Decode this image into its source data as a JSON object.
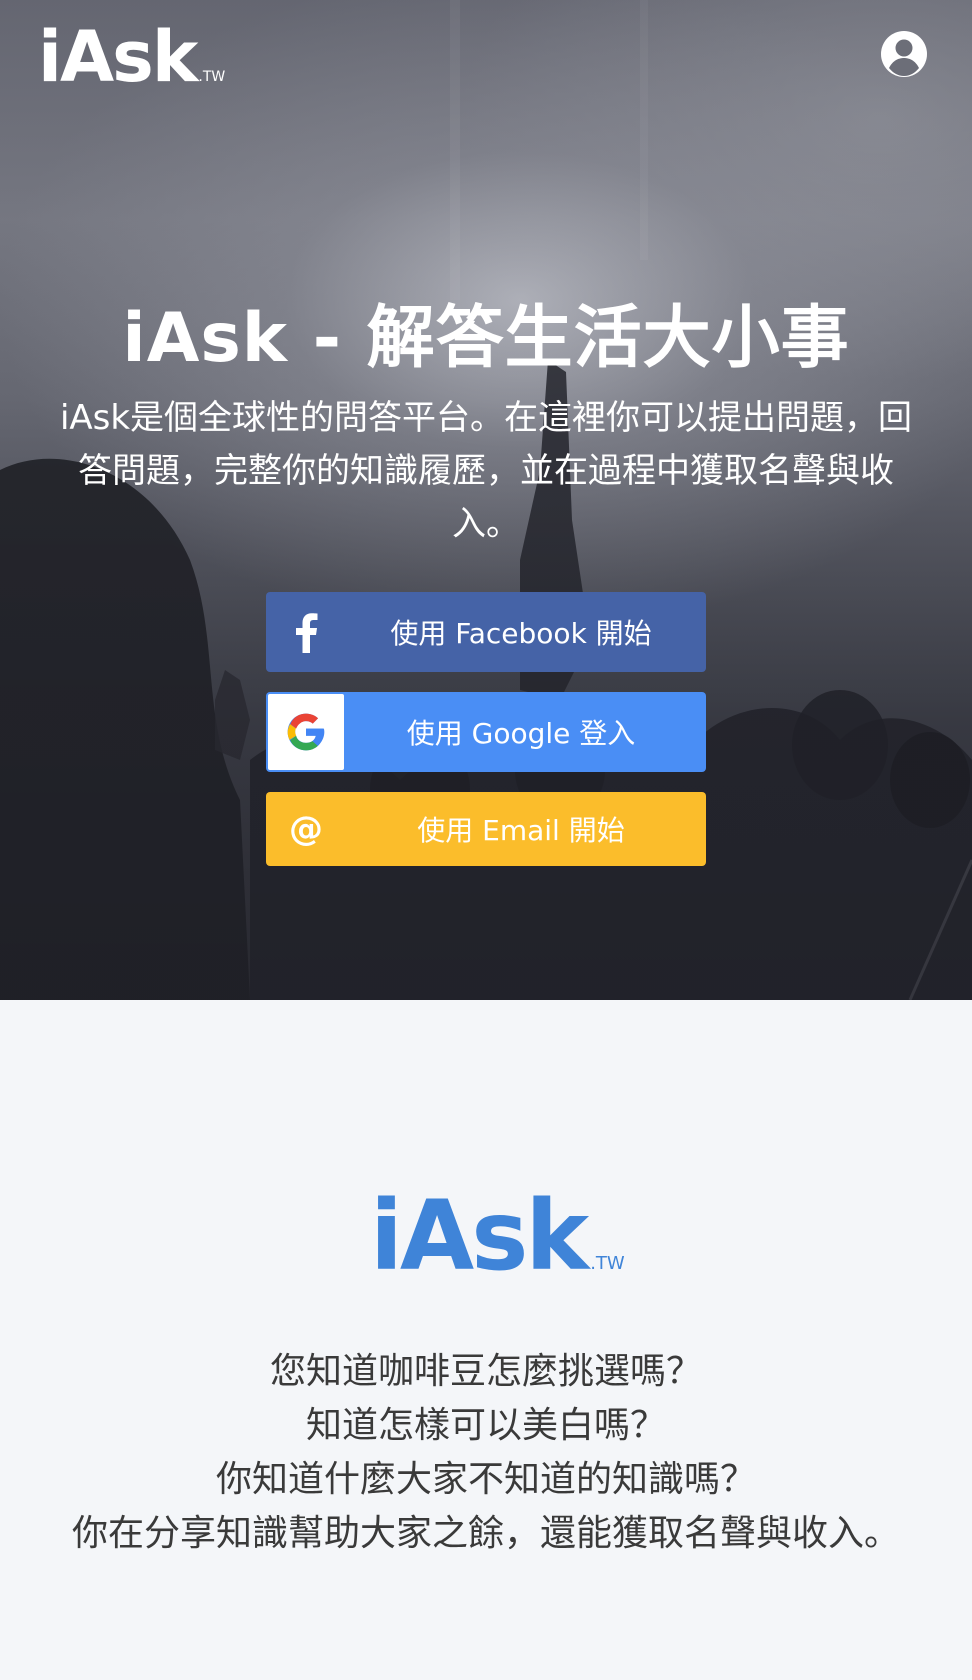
{
  "header": {
    "logo_text": "iAsk",
    "logo_suffix": ".TW",
    "user_icon": "user-circle-icon"
  },
  "hero": {
    "title": "iAsk - 解答生活大小事",
    "description": "iAsk是個全球性的問答平台。在這裡你可以提出問題，回答問題，完整你的知識履歷，並在過程中獲取名聲與收入。"
  },
  "login_buttons": {
    "facebook_label": "使用 Facebook 開始",
    "facebook_icon": "facebook-icon",
    "google_label": "使用 Google 登入",
    "google_icon": "google-icon",
    "email_label": "使用 Email 開始",
    "email_icon": "at-sign-icon"
  },
  "info": {
    "logo_text": "iAsk",
    "logo_suffix": ".TW",
    "lines": [
      "您知道咖啡豆怎麼挑選嗎？",
      "知道怎樣可以美白嗎？",
      "你知道什麼大家不知道的知識嗎？",
      "你在分享知識幫助大家之餘，還能獲取名聲與收入。"
    ]
  },
  "colors": {
    "facebook": "#4563a7",
    "google": "#4a8ef5",
    "email": "#fbbd2b",
    "brand_blue": "#3f84d8",
    "info_background": "#f4f6f9"
  }
}
